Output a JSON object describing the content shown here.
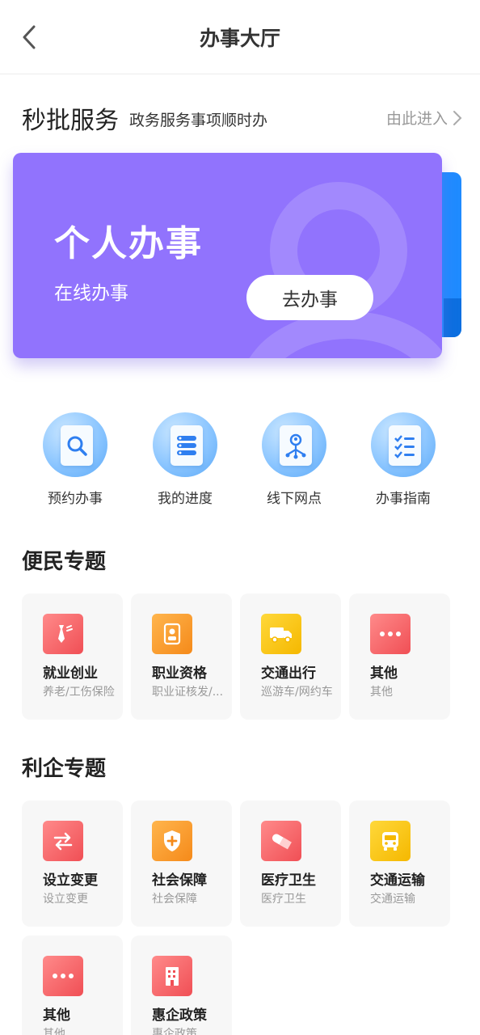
{
  "header": {
    "title": "办事大厅",
    "back_icon": "chevron-left-icon"
  },
  "quick_section": {
    "title": "秒批服务",
    "subtitle": "政务服务事项顺时办",
    "enter_label": "由此进入"
  },
  "card": {
    "title": "个人办事",
    "subtitle": "在线办事",
    "button_label": "去办事",
    "color": "#9173fd",
    "next_card_color": "#1f8bff"
  },
  "quick_actions": [
    {
      "label": "预约办事",
      "icon": "search-icon"
    },
    {
      "label": "我的进度",
      "icon": "progress-list-icon"
    },
    {
      "label": "线下网点",
      "icon": "network-location-icon"
    },
    {
      "label": "办事指南",
      "icon": "checklist-icon"
    }
  ],
  "convenience": {
    "title": "便民专题",
    "items": [
      {
        "name": "就业创业",
        "desc": "养老/工伤保险",
        "icon": "tie-icon",
        "color": "red"
      },
      {
        "name": "职业资格",
        "desc": "职业证核发/...",
        "icon": "id-badge-icon",
        "color": "orange"
      },
      {
        "name": "交通出行",
        "desc": "巡游车/网约车",
        "icon": "truck-icon",
        "color": "yellow"
      },
      {
        "name": "其他",
        "desc": "其他",
        "icon": "more-dots-icon",
        "color": "red"
      }
    ]
  },
  "enterprise": {
    "title": "利企专题",
    "items": [
      {
        "name": "设立变更",
        "desc": "设立变更",
        "icon": "swap-icon",
        "color": "red"
      },
      {
        "name": "社会保障",
        "desc": "社会保障",
        "icon": "shield-plus-icon",
        "color": "orange"
      },
      {
        "name": "医疗卫生",
        "desc": "医疗卫生",
        "icon": "pill-icon",
        "color": "red"
      },
      {
        "name": "交通运输",
        "desc": "交通运输",
        "icon": "bus-icon",
        "color": "yellow"
      },
      {
        "name": "其他",
        "desc": "其他",
        "icon": "more-dots-icon",
        "color": "red"
      },
      {
        "name": "惠企政策",
        "desc": "惠企政策",
        "icon": "building-icon",
        "color": "red"
      }
    ]
  }
}
